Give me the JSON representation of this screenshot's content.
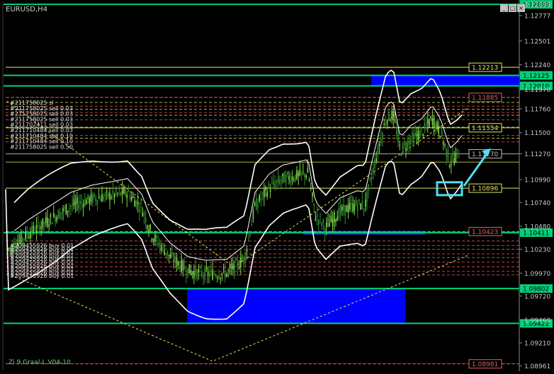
{
  "window": {
    "controls": [
      "_",
      "□",
      "×"
    ]
  },
  "chart_data": {
    "type": "candlestick",
    "title": "EURUSD,H4",
    "footer": "Zi 9 Graal-L V04-10",
    "ylim": [
      1.0894,
      1.129
    ],
    "y_ticks": [
      "1.12899",
      "1.12777",
      "1.12501",
      "1.12240",
      "1.11970",
      "1.11760",
      "1.11500",
      "1.11270",
      "1.10990",
      "1.10740",
      "1.10480",
      "1.10230",
      "1.09970",
      "1.09720",
      "1.09460",
      "1.09210",
      "1.08961"
    ],
    "horizontal_levels": [
      {
        "value": 1.12899,
        "label": "1.12899",
        "color": "#00d27a",
        "width": 2
      },
      {
        "value": 1.12125,
        "label": "1.12125",
        "color": "#00d27a",
        "width": 2
      },
      {
        "value": 1.1201,
        "label": "1.12010",
        "color": "#00d27a",
        "width": 2
      },
      {
        "value": 1.10411,
        "label": "1.10411",
        "color": "#00d27a",
        "width": 2
      },
      {
        "value": 1.09802,
        "label": "1.09802",
        "color": "#00d27a",
        "width": 2
      },
      {
        "value": 1.09422,
        "label": "1.09422",
        "color": "#00d27a",
        "width": 2
      }
    ],
    "line_labels": [
      {
        "value": 1.12213,
        "label": "1.12213",
        "color": "#e6e65a"
      },
      {
        "value": 1.11885,
        "label": "1.11885",
        "color": "#e06060"
      },
      {
        "value": 1.11554,
        "label": "1.11554",
        "color": "#e6e65a"
      },
      {
        "value": 1.1127,
        "label": "1.11270",
        "color": "#c0c0c0"
      },
      {
        "value": 1.10896,
        "label": "1.10896",
        "color": "#e6e65a"
      },
      {
        "value": 1.10423,
        "label": "1.10423",
        "color": "#e06060"
      },
      {
        "value": 1.08981,
        "label": "1.08981",
        "color": "#e06060"
      }
    ],
    "order_labels_upper": [
      "#211758025 sl",
      "#211758025 sell 0.03",
      "#211758025 sell 0.03",
      "#211758025 sell 0.03",
      "#211702411 sell 0.03",
      "#211710484 sell 0.03",
      "#211710484 sell 0.10",
      "#211710484 sell 0.10",
      "#211758025 sell 0.50"
    ],
    "order_labels_lower": [
      "#209455926 buy 0.01",
      "#209455926 buy 0.01",
      "#209455926 buy 0.01",
      "#209455926 buy 0.01",
      "#209455926 buy 0.01",
      "#209455926 buy 0.01",
      "#209455926 buy 0.01",
      "#209455926 buy 0.01",
      "#209455926 buy 0.01",
      "#209455926 buy 0.01"
    ],
    "zones": [
      {
        "x0": 524,
        "x1": 733,
        "top": 1.12125,
        "bottom": 1.1201,
        "color": "#0000ff"
      },
      {
        "x0": 428,
        "x1": 600,
        "top": 1.1043,
        "bottom": 1.10392,
        "color": "#1e3cff"
      },
      {
        "x0": 264,
        "x1": 572,
        "top": 1.09802,
        "bottom": 1.09422,
        "color": "#0000ff"
      }
    ],
    "colors": {
      "up": "#7ddc4a",
      "down": "#2f8a2f",
      "bands": "#ffffff",
      "ma": "#e6e65a",
      "arrow": "#50e0f0"
    }
  }
}
